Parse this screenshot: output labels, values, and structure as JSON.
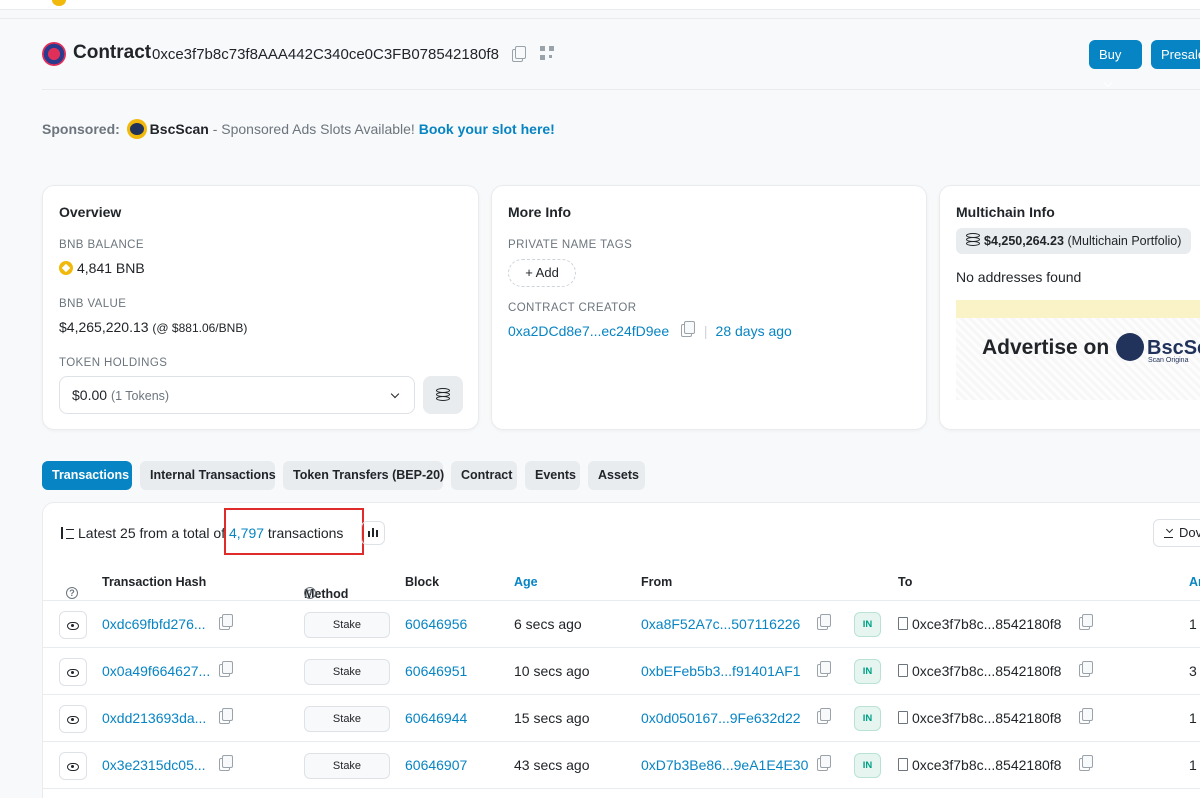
{
  "header": {
    "title": "Contract",
    "address": "0xce3f7b8c73f8AAA442C340ce0C3FB078542180f8",
    "buy_label": "Buy",
    "presale_label": "Presale"
  },
  "sponsor": {
    "label": "Sponsored:",
    "brand": "BscScan",
    "text": " - Sponsored Ads Slots Available! ",
    "link": "Book your slot here!"
  },
  "overview": {
    "title": "Overview",
    "balance_label": "BNB BALANCE",
    "balance_value": "4,841 BNB",
    "value_label": "BNB VALUE",
    "value_amount": "$4,265,220.13",
    "value_rate": "(@ $881.06/BNB)",
    "holdings_label": "TOKEN HOLDINGS",
    "holdings_value": "$0.00",
    "holdings_count": "(1 Tokens)"
  },
  "more_info": {
    "title": "More Info",
    "tags_label": "PRIVATE NAME TAGS",
    "add_label": "+ Add",
    "creator_label": "CONTRACT CREATOR",
    "creator_address": "0xa2DCd8e7...ec24fD9ee",
    "creator_age": "28 days ago"
  },
  "multichain": {
    "title": "Multichain Info",
    "portfolio_value": "$4,250,264.23",
    "portfolio_label": "(Multichain Portfolio)",
    "no_addresses": "No addresses found",
    "ad_text": "Advertise on",
    "ad_brand": "BscSc",
    "ad_tagline": "Scan Origina"
  },
  "tabs": [
    {
      "label": "Transactions",
      "active": true
    },
    {
      "label": "Internal Transactions",
      "active": false
    },
    {
      "label": "Token Transfers (BEP-20)",
      "active": false
    },
    {
      "label": "Contract",
      "active": false
    },
    {
      "label": "Events",
      "active": false
    },
    {
      "label": "Assets",
      "active": false
    }
  ],
  "summary": {
    "prefix": "Latest 25 from a total of ",
    "count": "4,797",
    "suffix": " transactions",
    "download_label": "Dov"
  },
  "table": {
    "columns": [
      "Transaction Hash",
      "Method",
      "Block",
      "Age",
      "From",
      "To",
      "Ar"
    ],
    "rows": [
      {
        "hash": "0xdc69fbfd276...",
        "method": "Stake",
        "block": "60646956",
        "age": "6 secs ago",
        "from": "0xa8F52A7c...507116226",
        "direction": "IN",
        "to": "0xce3f7b8c...8542180f8",
        "amount": "1"
      },
      {
        "hash": "0x0a49f664627...",
        "method": "Stake",
        "block": "60646951",
        "age": "10 secs ago",
        "from": "0xbEFeb5b3...f91401AF1",
        "direction": "IN",
        "to": "0xce3f7b8c...8542180f8",
        "amount": "3"
      },
      {
        "hash": "0xdd213693da...",
        "method": "Stake",
        "block": "60646944",
        "age": "15 secs ago",
        "from": "0x0d050167...9Fe632d22",
        "direction": "IN",
        "to": "0xce3f7b8c...8542180f8",
        "amount": "1"
      },
      {
        "hash": "0x3e2315dc05...",
        "method": "Stake",
        "block": "60646907",
        "age": "43 secs ago",
        "from": "0xD7b3Be86...9eA1E4E30",
        "direction": "IN",
        "to": "0xce3f7b8c...8542180f8",
        "amount": "1"
      }
    ]
  },
  "colors": {
    "accent": "#0784c3",
    "highlight_box": "#e02b2b",
    "in_badge": "#00a186"
  }
}
